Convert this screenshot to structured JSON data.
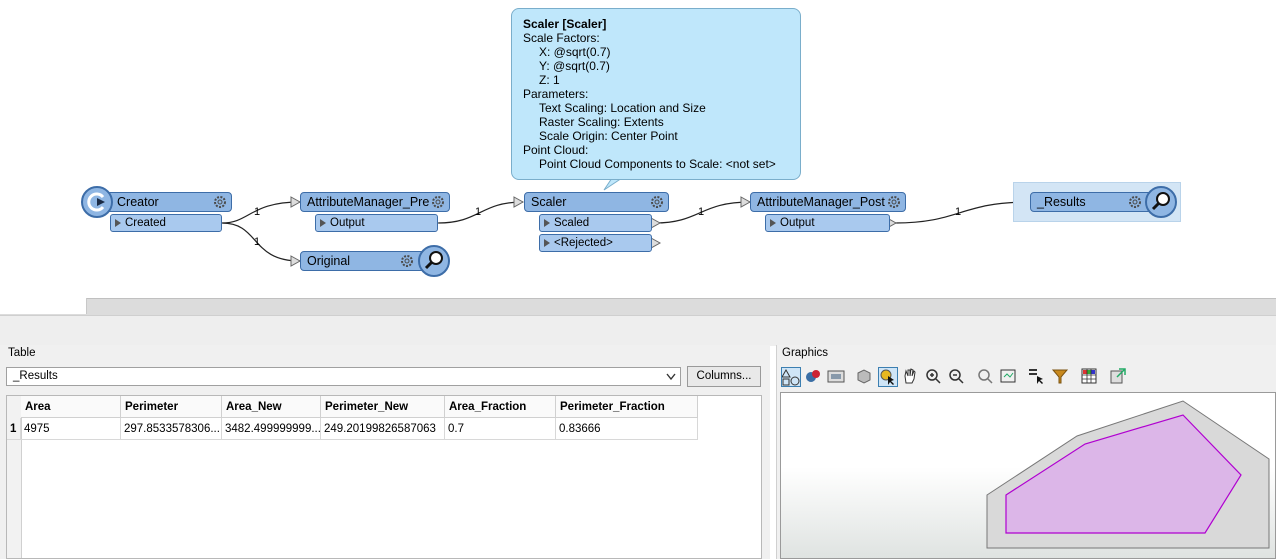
{
  "canvas": {
    "nodes": {
      "creator": {
        "title": "Creator",
        "port": "Created"
      },
      "attr_pre": {
        "title": "AttributeManager_Pre",
        "port": "Output"
      },
      "original": {
        "title": "Original"
      },
      "scaler": {
        "title": "Scaler",
        "ports": [
          "Scaled",
          "<Rejected>"
        ]
      },
      "attr_post": {
        "title": "AttributeManager_Post",
        "port": "Output"
      },
      "results": {
        "title": "_Results"
      }
    },
    "link_counts": [
      "1",
      "1",
      "1",
      "1",
      "1"
    ]
  },
  "tooltip": {
    "title": "Scaler [Scaler]",
    "lines": [
      "Scale Factors:",
      "X: @sqrt(0.7)",
      "Y: @sqrt(0.7)",
      "Z: 1",
      "Parameters:",
      "Text Scaling: Location and Size",
      "Raster Scaling: Extents",
      "Scale Origin: Center Point",
      "Point Cloud:",
      "Point Cloud Components to Scale: <not set>"
    ]
  },
  "table": {
    "label": "Table",
    "dataset": "_Results",
    "columns_button": "Columns...",
    "headers": [
      "Area",
      "Perimeter",
      "Area_New",
      "Perimeter_New",
      "Area_Fraction",
      "Perimeter_Fraction"
    ],
    "rows": [
      {
        "index": "1",
        "cells": [
          "4975",
          "297.8533578306...",
          "3482.499999999...",
          "249.20199826587063",
          "0.7",
          "0.83666"
        ]
      }
    ]
  },
  "graphics": {
    "label": "Graphics",
    "toolbar_icons": [
      "shapes-icon",
      "fill-icon",
      "background-map-icon",
      "3d-view-icon",
      "select-info-icon",
      "pan-icon",
      "zoom-in-icon",
      "zoom-out-icon",
      "zoom-extent-icon",
      "zoom-selection-icon",
      "select-features-icon",
      "filter-icon",
      "table-view-icon",
      "export-icon"
    ],
    "colors": {
      "outer_fill": "#d9d9d9",
      "inner_fill": "#dcb6e8",
      "inner_stroke": "#b000d0"
    }
  }
}
